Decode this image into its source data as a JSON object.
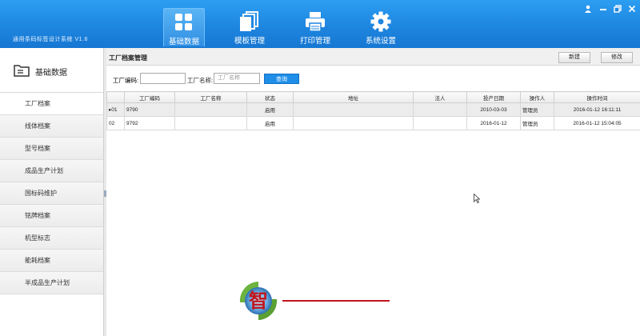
{
  "app": {
    "title": "通用条码标签设计系统 V1.6"
  },
  "nav": [
    {
      "label": "基础数据",
      "icon": "grid-icon",
      "active": true
    },
    {
      "label": "模板管理",
      "icon": "stack-icon",
      "active": false
    },
    {
      "label": "打印管理",
      "icon": "printer-icon",
      "active": false
    },
    {
      "label": "系统设置",
      "icon": "gear-icon",
      "active": false
    }
  ],
  "sidebar": {
    "header": "基础数据",
    "items": [
      {
        "label": "工厂档案"
      },
      {
        "label": "线体档案"
      },
      {
        "label": "型号档案"
      },
      {
        "label": "成品生产计划"
      },
      {
        "label": "国标码维护"
      },
      {
        "label": "铭牌档案"
      },
      {
        "label": "机型标志"
      },
      {
        "label": "能耗档案"
      },
      {
        "label": "半成品生产计划"
      }
    ]
  },
  "content": {
    "title": "工厂档案管理",
    "new_label": "新建",
    "edit_label": "修改",
    "search": {
      "code_label": "工厂编码:",
      "code_value": "",
      "name_label": "工厂名称:",
      "name_placeholder": "工厂名称",
      "query_label": "查询"
    },
    "table": {
      "columns": [
        "",
        "工厂编码",
        "工厂名称",
        "状态",
        "地址",
        "法人",
        "投产日期",
        "操作人",
        "操作时间"
      ],
      "rows": [
        {
          "num": "01",
          "code": "9790",
          "name": "",
          "status": "启用",
          "address": "",
          "legal": "",
          "date": "2010-03-03",
          "operator": "管理员",
          "time": "2016-01-12 16:11:11"
        },
        {
          "num": "02",
          "code": "9792",
          "name": "",
          "status": "启用",
          "address": "",
          "legal": "",
          "date": "2016-01-12",
          "operator": "管理员",
          "time": "2016-01-12 15:04:05"
        }
      ]
    }
  },
  "logo": {
    "char": "智",
    "accent": "#c0161c"
  },
  "colors": {
    "header": "#1e86e0",
    "accent": "#1e8ee8"
  }
}
